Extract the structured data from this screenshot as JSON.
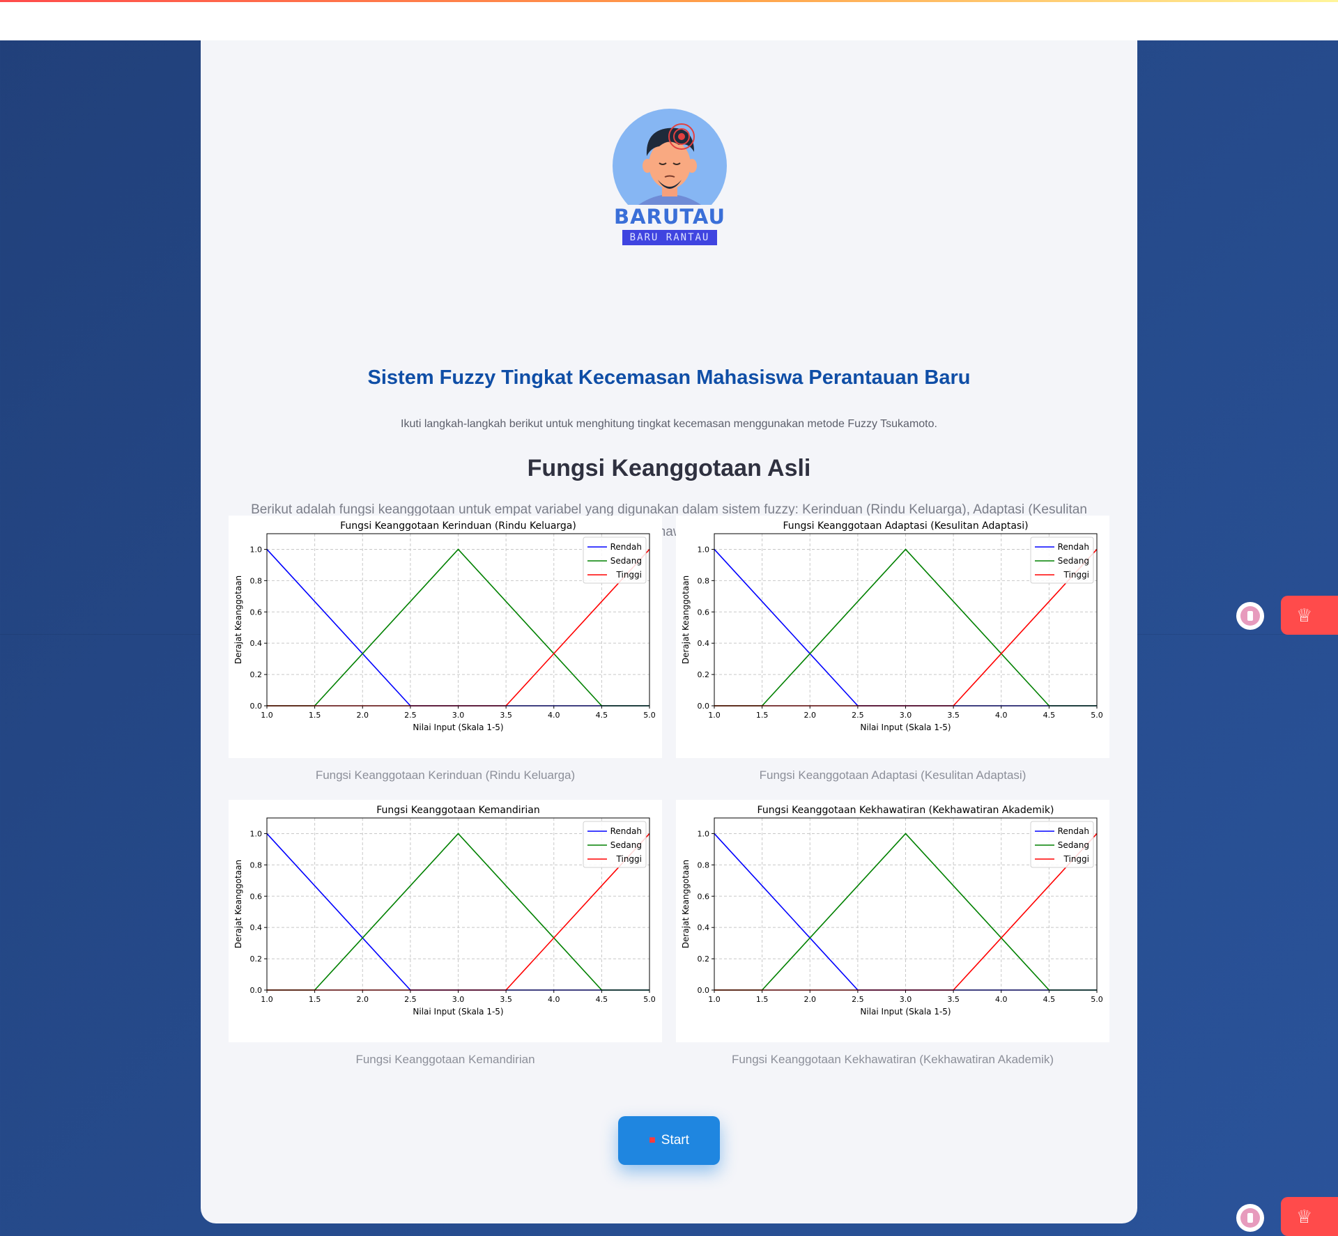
{
  "app": {
    "logo_title": "BARUTAU",
    "logo_subtitle": "BARU RANTAU"
  },
  "header": {
    "title": "Sistem Fuzzy Tingkat Kecemasan Mahasiswa Perantauan Baru",
    "intro": "Ikuti langkah-langkah berikut untuk menghitung tingkat kecemasan menggunakan metode Fuzzy Tsukamoto."
  },
  "section": {
    "title": "Fungsi Keanggotaan Asli",
    "description": "Berikut adalah fungsi keanggotaan untuk empat variabel yang digunakan dalam sistem fuzzy: Kerinduan (Rindu Keluarga), Adaptasi (Kesulitan Adaptasi), Kemandirian, dan Kekhawatiran (Kekhawatiran Akademik)."
  },
  "captions": [
    "Fungsi Keanggotaan Kerinduan (Rindu Keluarga)",
    "Fungsi Keanggotaan Adaptasi (Kesulitan Adaptasi)",
    "Fungsi Keanggotaan Kemandirian",
    "Fungsi Keanggotaan Kekhawatiran (Kekhawatiran Akademik)"
  ],
  "start_button": {
    "icon": "car-icon",
    "label": "Start"
  },
  "colors": {
    "accent": "#0f4ea6",
    "button": "#1f86e0",
    "rendah": "#0000ff",
    "sedang": "#008000",
    "tinggi": "#ff0000"
  },
  "chart_data": [
    {
      "type": "line",
      "title": "Fungsi Keanggotaan Kerinduan (Rindu Keluarga)",
      "xlabel": "Nilai Input (Skala 1-5)",
      "ylabel": "Derajat Keanggotaan",
      "xlim": [
        1.0,
        5.0
      ],
      "ylim": [
        0.0,
        1.1
      ],
      "xticks": [
        "1.0",
        "1.5",
        "2.0",
        "2.5",
        "3.0",
        "3.5",
        "4.0",
        "4.5",
        "5.0"
      ],
      "yticks": [
        "0.0",
        "0.2",
        "0.4",
        "0.6",
        "0.8",
        "1.0"
      ],
      "grid": true,
      "legend": "top-right",
      "series": [
        {
          "name": "Rendah",
          "x": [
            1.0,
            2.5,
            5.0
          ],
          "y": [
            1.0,
            0.0,
            0.0
          ]
        },
        {
          "name": "Sedang",
          "x": [
            1.0,
            1.5,
            3.0,
            4.5,
            5.0
          ],
          "y": [
            0.0,
            0.0,
            1.0,
            0.0,
            0.0
          ]
        },
        {
          "name": "Tinggi",
          "x": [
            1.0,
            3.5,
            5.0
          ],
          "y": [
            0.0,
            0.0,
            1.0
          ]
        }
      ]
    },
    {
      "type": "line",
      "title": "Fungsi Keanggotaan Adaptasi (Kesulitan Adaptasi)",
      "xlabel": "Nilai Input (Skala 1-5)",
      "ylabel": "Derajat Keanggotaan",
      "xlim": [
        1.0,
        5.0
      ],
      "ylim": [
        0.0,
        1.1
      ],
      "xticks": [
        "1.0",
        "1.5",
        "2.0",
        "2.5",
        "3.0",
        "3.5",
        "4.0",
        "4.5",
        "5.0"
      ],
      "yticks": [
        "0.0",
        "0.2",
        "0.4",
        "0.6",
        "0.8",
        "1.0"
      ],
      "grid": true,
      "legend": "top-right",
      "series": [
        {
          "name": "Rendah",
          "x": [
            1.0,
            2.5,
            5.0
          ],
          "y": [
            1.0,
            0.0,
            0.0
          ]
        },
        {
          "name": "Sedang",
          "x": [
            1.0,
            1.5,
            3.0,
            4.5,
            5.0
          ],
          "y": [
            0.0,
            0.0,
            1.0,
            0.0,
            0.0
          ]
        },
        {
          "name": "Tinggi",
          "x": [
            1.0,
            3.5,
            5.0
          ],
          "y": [
            0.0,
            0.0,
            1.0
          ]
        }
      ]
    },
    {
      "type": "line",
      "title": "Fungsi Keanggotaan Kemandirian",
      "xlabel": "Nilai Input (Skala 1-5)",
      "ylabel": "Derajat Keanggotaan",
      "xlim": [
        1.0,
        5.0
      ],
      "ylim": [
        0.0,
        1.1
      ],
      "xticks": [
        "1.0",
        "1.5",
        "2.0",
        "2.5",
        "3.0",
        "3.5",
        "4.0",
        "4.5",
        "5.0"
      ],
      "yticks": [
        "0.0",
        "0.2",
        "0.4",
        "0.6",
        "0.8",
        "1.0"
      ],
      "grid": true,
      "legend": "top-right",
      "series": [
        {
          "name": "Rendah",
          "x": [
            1.0,
            2.5,
            5.0
          ],
          "y": [
            1.0,
            0.0,
            0.0
          ]
        },
        {
          "name": "Sedang",
          "x": [
            1.0,
            1.5,
            3.0,
            4.5,
            5.0
          ],
          "y": [
            0.0,
            0.0,
            1.0,
            0.0,
            0.0
          ]
        },
        {
          "name": "Tinggi",
          "x": [
            1.0,
            3.5,
            5.0
          ],
          "y": [
            0.0,
            0.0,
            1.0
          ]
        }
      ]
    },
    {
      "type": "line",
      "title": "Fungsi Keanggotaan Kekhawatiran (Kekhawatiran Akademik)",
      "xlabel": "Nilai Input (Skala 1-5)",
      "ylabel": "Derajat Keanggotaan",
      "xlim": [
        1.0,
        5.0
      ],
      "ylim": [
        0.0,
        1.1
      ],
      "xticks": [
        "1.0",
        "1.5",
        "2.0",
        "2.5",
        "3.0",
        "3.5",
        "4.0",
        "4.5",
        "5.0"
      ],
      "yticks": [
        "0.0",
        "0.2",
        "0.4",
        "0.6",
        "0.8",
        "1.0"
      ],
      "grid": true,
      "legend": "top-right",
      "series": [
        {
          "name": "Rendah",
          "x": [
            1.0,
            2.5,
            5.0
          ],
          "y": [
            1.0,
            0.0,
            0.0
          ]
        },
        {
          "name": "Sedang",
          "x": [
            1.0,
            1.5,
            3.0,
            4.5,
            5.0
          ],
          "y": [
            0.0,
            0.0,
            1.0,
            0.0,
            0.0
          ]
        },
        {
          "name": "Tinggi",
          "x": [
            1.0,
            3.5,
            5.0
          ],
          "y": [
            0.0,
            0.0,
            1.0
          ]
        }
      ]
    }
  ],
  "side_controls": {
    "avatar_icon": "user-avatar-icon",
    "crown_icon": "crown-icon"
  }
}
